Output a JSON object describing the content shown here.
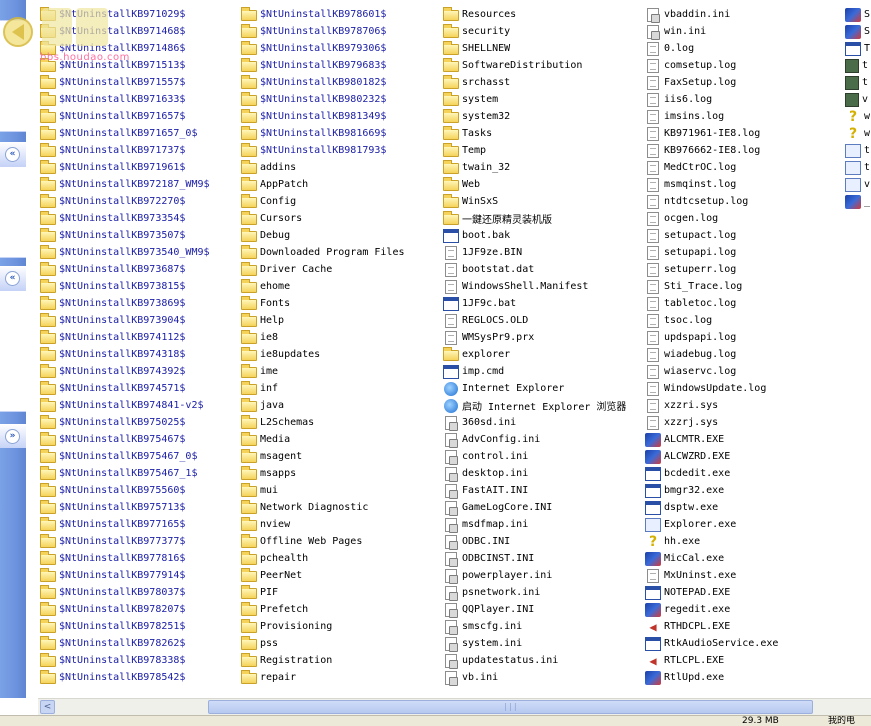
{
  "watermark": {
    "logo_text": "bbs.houdao.com"
  },
  "task_pane": {
    "collapse_buttons": [
      "«",
      "«",
      "»"
    ]
  },
  "columns": [
    {
      "type": "folder",
      "items": [
        "$NtUninstallKB971029$",
        "$NtUninstallKB971468$",
        "$NtUninstallKB971486$",
        "$NtUninstallKB971513$",
        "$NtUninstallKB971557$",
        "$NtUninstallKB971633$",
        "$NtUninstallKB971657$",
        "$NtUninstallKB971657_0$",
        "$NtUninstallKB971737$",
        "$NtUninstallKB971961$",
        "$NtUninstallKB972187_WM9$",
        "$NtUninstallKB972270$",
        "$NtUninstallKB973354$",
        "$NtUninstallKB973507$",
        "$NtUninstallKB973540_WM9$",
        "$NtUninstallKB973687$",
        "$NtUninstallKB973815$",
        "$NtUninstallKB973869$",
        "$NtUninstallKB973904$",
        "$NtUninstallKB974112$",
        "$NtUninstallKB974318$",
        "$NtUninstallKB974392$",
        "$NtUninstallKB974571$",
        "$NtUninstallKB974841-v2$",
        "$NtUninstallKB975025$",
        "$NtUninstallKB975467$",
        "$NtUninstallKB975467_0$",
        "$NtUninstallKB975467_1$",
        "$NtUninstallKB975560$",
        "$NtUninstallKB975713$",
        "$NtUninstallKB977165$",
        "$NtUninstallKB977377$",
        "$NtUninstallKB977816$",
        "$NtUninstallKB977914$",
        "$NtUninstallKB978037$",
        "$NtUninstallKB978207$",
        "$NtUninstallKB978251$",
        "$NtUninstallKB978262$",
        "$NtUninstallKB978338$",
        "$NtUninstallKB978542$"
      ]
    },
    {
      "type": "folder",
      "items": [
        "$NtUninstallKB978601$",
        "$NtUninstallKB978706$",
        "$NtUninstallKB979306$",
        "$NtUninstallKB979683$",
        "$NtUninstallKB980182$",
        "$NtUninstallKB980232$",
        "$NtUninstallKB981349$",
        "$NtUninstallKB981669$",
        "$NtUninstallKB981793$",
        "addins",
        "AppPatch",
        "Config",
        "Cursors",
        "Debug",
        "Downloaded Program Files",
        "Driver Cache",
        "ehome",
        "Fonts",
        "Help",
        "ie8",
        "ie8updates",
        "ime",
        "inf",
        "java",
        "L2Schemas",
        "Media",
        "msagent",
        "msapps",
        "mui",
        "Network Diagnostic",
        "nview",
        "Offline Web Pages",
        "pchealth",
        "PeerNet",
        "PIF",
        "Prefetch",
        "Provisioning",
        "pss",
        "Registration",
        "repair"
      ]
    },
    {
      "type": "mixed",
      "items": [
        {
          "name": "Resources",
          "icon": "folder"
        },
        {
          "name": "security",
          "icon": "folder"
        },
        {
          "name": "SHELLNEW",
          "icon": "folder"
        },
        {
          "name": "SoftwareDistribution",
          "icon": "folder"
        },
        {
          "name": "srchasst",
          "icon": "folder"
        },
        {
          "name": "system",
          "icon": "folder"
        },
        {
          "name": "system32",
          "icon": "folder"
        },
        {
          "name": "Tasks",
          "icon": "folder"
        },
        {
          "name": "Temp",
          "icon": "folder"
        },
        {
          "name": "twain_32",
          "icon": "folder"
        },
        {
          "name": "Web",
          "icon": "folder"
        },
        {
          "name": "WinSxS",
          "icon": "folder"
        },
        {
          "name": "一鍵还原精灵装机版",
          "icon": "folder"
        },
        {
          "name": "boot.bak",
          "icon": "exe"
        },
        {
          "name": "1JF9ze.BIN",
          "icon": "file"
        },
        {
          "name": "bootstat.dat",
          "icon": "file"
        },
        {
          "name": "WindowsShell.Manifest",
          "icon": "file"
        },
        {
          "name": "1JF9c.bat",
          "icon": "exe"
        },
        {
          "name": "REGLOCS.OLD",
          "icon": "file"
        },
        {
          "name": "WMSysPr9.prx",
          "icon": "file"
        },
        {
          "name": "explorer",
          "icon": "folder"
        },
        {
          "name": "imp.cmd",
          "icon": "exe"
        },
        {
          "name": "Internet Explorer",
          "icon": "ie"
        },
        {
          "name": "启动 Internet Explorer 浏览器",
          "icon": "ie"
        },
        {
          "name": "360sd.ini",
          "icon": "ini"
        },
        {
          "name": "AdvConfig.ini",
          "icon": "ini"
        },
        {
          "name": "control.ini",
          "icon": "ini"
        },
        {
          "name": "desktop.ini",
          "icon": "ini"
        },
        {
          "name": "FastAIT.INI",
          "icon": "ini"
        },
        {
          "name": "GameLogCore.INI",
          "icon": "ini"
        },
        {
          "name": "msdfmap.ini",
          "icon": "ini"
        },
        {
          "name": "ODBC.INI",
          "icon": "ini"
        },
        {
          "name": "ODBCINST.INI",
          "icon": "ini"
        },
        {
          "name": "powerplayer.ini",
          "icon": "ini"
        },
        {
          "name": "psnetwork.ini",
          "icon": "ini"
        },
        {
          "name": "QQPlayer.INI",
          "icon": "ini"
        },
        {
          "name": "smscfg.ini",
          "icon": "ini"
        },
        {
          "name": "system.ini",
          "icon": "ini"
        },
        {
          "name": "updatestatus.ini",
          "icon": "ini"
        },
        {
          "name": "vb.ini",
          "icon": "ini"
        }
      ]
    },
    {
      "type": "mixed",
      "items": [
        {
          "name": "vbaddin.ini",
          "icon": "ini"
        },
        {
          "name": "win.ini",
          "icon": "ini"
        },
        {
          "name": "0.log",
          "icon": "file"
        },
        {
          "name": "comsetup.log",
          "icon": "file"
        },
        {
          "name": "FaxSetup.log",
          "icon": "file"
        },
        {
          "name": "iis6.log",
          "icon": "file"
        },
        {
          "name": "imsins.log",
          "icon": "file"
        },
        {
          "name": "KB971961-IE8.log",
          "icon": "file"
        },
        {
          "name": "KB976662-IE8.log",
          "icon": "file"
        },
        {
          "name": "MedCtrOC.log",
          "icon": "file"
        },
        {
          "name": "msmqinst.log",
          "icon": "file"
        },
        {
          "name": "ntdtcsetup.log",
          "icon": "file"
        },
        {
          "name": "ocgen.log",
          "icon": "file"
        },
        {
          "name": "setupact.log",
          "icon": "file"
        },
        {
          "name": "setupapi.log",
          "icon": "file"
        },
        {
          "name": "setuperr.log",
          "icon": "file"
        },
        {
          "name": "Sti_Trace.log",
          "icon": "file"
        },
        {
          "name": "tabletoc.log",
          "icon": "file"
        },
        {
          "name": "tsoc.log",
          "icon": "file"
        },
        {
          "name": "updspapi.log",
          "icon": "file"
        },
        {
          "name": "wiadebug.log",
          "icon": "file"
        },
        {
          "name": "wiaservc.log",
          "icon": "file"
        },
        {
          "name": "WindowsUpdate.log",
          "icon": "file"
        },
        {
          "name": "xzzri.sys",
          "icon": "file"
        },
        {
          "name": "xzzrj.sys",
          "icon": "file"
        },
        {
          "name": "ALCMTR.EXE",
          "icon": "colorexe"
        },
        {
          "name": "ALCWZRD.EXE",
          "icon": "colorexe"
        },
        {
          "name": "bcdedit.exe",
          "icon": "exe"
        },
        {
          "name": "bmgr32.exe",
          "icon": "exe"
        },
        {
          "name": "dsptw.exe",
          "icon": "exe"
        },
        {
          "name": "Explorer.exe",
          "icon": "webpage"
        },
        {
          "name": "hh.exe",
          "icon": "help"
        },
        {
          "name": "MicCal.exe",
          "icon": "colorexe"
        },
        {
          "name": "MxUninst.exe",
          "icon": "file"
        },
        {
          "name": "NOTEPAD.EXE",
          "icon": "exe"
        },
        {
          "name": "regedit.exe",
          "icon": "colorexe"
        },
        {
          "name": "RTHDCPL.EXE",
          "icon": "audio"
        },
        {
          "name": "RtkAudioService.exe",
          "icon": "exe"
        },
        {
          "name": "RTLCPL.EXE",
          "icon": "audio"
        },
        {
          "name": "RtlUpd.exe",
          "icon": "colorexe"
        }
      ]
    },
    {
      "type": "partial",
      "items": [
        {
          "name": "S",
          "icon": "colorexe"
        },
        {
          "name": "S",
          "icon": "colorexe"
        },
        {
          "name": "T",
          "icon": "exe"
        },
        {
          "name": "t",
          "icon": "small"
        },
        {
          "name": "t",
          "icon": "small"
        },
        {
          "name": "v",
          "icon": "small"
        },
        {
          "name": "w",
          "icon": "help"
        },
        {
          "name": "w",
          "icon": "help"
        },
        {
          "name": "t",
          "icon": "webpage"
        },
        {
          "name": "t",
          "icon": "webpage"
        },
        {
          "name": "v",
          "icon": "webpage"
        },
        {
          "name": "_",
          "icon": "colorexe"
        }
      ]
    }
  ],
  "scrollbar": {
    "left_arrow": "<",
    "thumb_grip": "|||"
  },
  "statusbar": {
    "size": "29.3 MB",
    "location": "我的电"
  }
}
